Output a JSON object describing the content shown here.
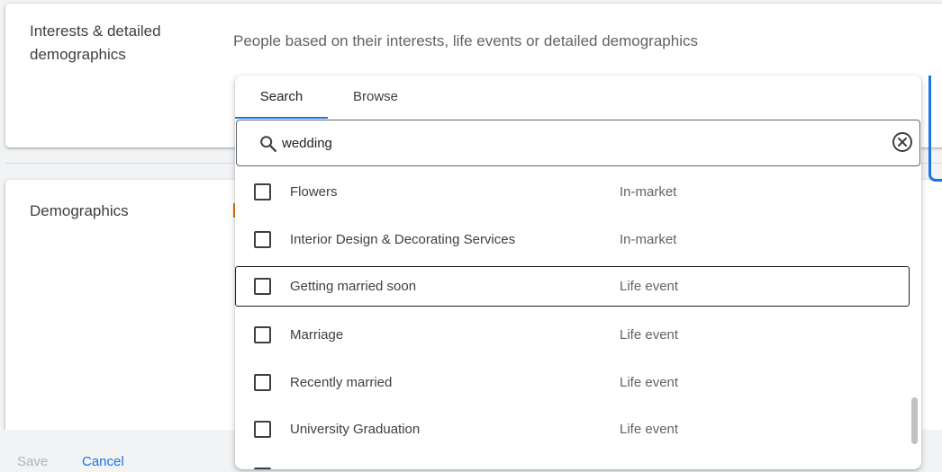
{
  "interests": {
    "title": "Interests & detailed demographics",
    "description": "People based on their interests, life events or detailed demographics"
  },
  "demographics": {
    "title": "Demographics"
  },
  "dropdown": {
    "tabs": [
      {
        "label": "Search",
        "active": true
      },
      {
        "label": "Browse",
        "active": false
      }
    ],
    "search": {
      "value": "wedding",
      "icon": "search-icon",
      "clear_icon": "clear-icon"
    },
    "results": [
      {
        "label": "Flowers",
        "type": "In-market",
        "checked": false
      },
      {
        "label": "Interior Design & Decorating Services",
        "type": "In-market",
        "checked": false
      },
      {
        "label": "Getting married soon",
        "type": "Life event",
        "checked": false,
        "focused": true
      },
      {
        "label": "Marriage",
        "type": "Life event",
        "checked": false
      },
      {
        "label": "Recently married",
        "type": "Life event",
        "checked": false
      },
      {
        "label": "University Graduation",
        "type": "Life event",
        "checked": false
      }
    ]
  },
  "footer": {
    "save_label": "Save",
    "cancel_label": "Cancel"
  },
  "colors": {
    "accent": "#1a73e8",
    "text": "#3c4043",
    "secondary_text": "#5f6368",
    "disabled": "#b0b3b8",
    "background": "#f1f3f4"
  }
}
